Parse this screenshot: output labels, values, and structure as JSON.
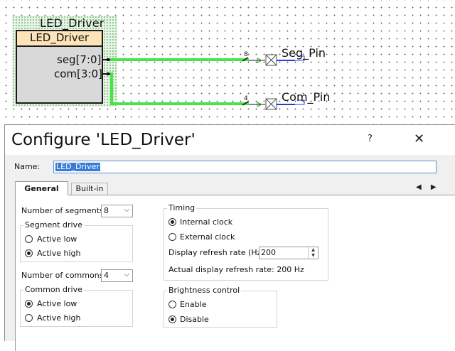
{
  "schematic": {
    "component_instance": "LED_Driver",
    "component_type": "LED_Driver",
    "ports": [
      "seg[7:0]",
      "com[3:0]"
    ],
    "bus_widths": [
      "8",
      "4"
    ],
    "pins": [
      "Seg_Pin",
      "Com_Pin"
    ],
    "colors": {
      "wire": "#44e544",
      "component_head": "#fce3b8",
      "component_body": "#d9d9d9",
      "pin_wire": "#1f3fd6"
    }
  },
  "dialog": {
    "title": "Configure 'LED_Driver'",
    "help_label": "?",
    "close_label": "✕",
    "name_label": "Name:",
    "name_value": "LED_Driver",
    "tabs": [
      {
        "label": "General",
        "active": true
      },
      {
        "label": "Built-in",
        "active": false
      }
    ],
    "tab_nav_label": "◀ ▶",
    "general": {
      "segments_label": "Number of segments:",
      "segments_value": "8",
      "segment_drive": {
        "title": "Segment drive",
        "options": [
          {
            "label": "Active low",
            "selected": false
          },
          {
            "label": "Active high",
            "selected": true
          }
        ]
      },
      "commons_label": "Number of commons:",
      "commons_value": "4",
      "common_drive": {
        "title": "Common drive",
        "options": [
          {
            "label": "Active low",
            "selected": true
          },
          {
            "label": "Active high",
            "selected": false
          }
        ]
      },
      "timing": {
        "title": "Timing",
        "options": [
          {
            "label": "Internal clock",
            "selected": true
          },
          {
            "label": "External clock",
            "selected": false
          }
        ],
        "refresh_label": "Display refresh rate (Hz)",
        "refresh_value": "200",
        "actual_refresh": "Actual display refresh rate: 200 Hz"
      },
      "brightness": {
        "title": "Brightness control",
        "options": [
          {
            "label": "Enable",
            "selected": false
          },
          {
            "label": "Disable",
            "selected": true
          }
        ]
      }
    }
  }
}
